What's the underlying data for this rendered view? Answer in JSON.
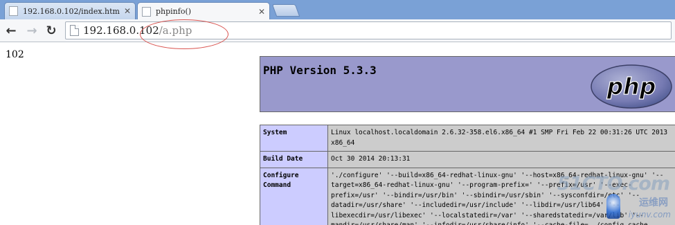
{
  "tabs": [
    {
      "title": "192.168.0.102/index.htm",
      "active": false
    },
    {
      "title": "phpinfo()",
      "active": true
    }
  ],
  "toolbar": {
    "back_icon": "back-arrow-icon",
    "forward_icon": "forward-arrow-icon",
    "reload_icon": "reload-icon",
    "url_host": "192.168.0.102",
    "url_path": "/a.php"
  },
  "page": {
    "output_text": "102",
    "php_version": "PHP Version 5.3.3",
    "logo_text": "php",
    "rows": [
      {
        "key": "System",
        "value": "Linux localhost.localdomain 2.6.32-358.el6.x86_64 #1 SMP Fri Feb 22 00:31:26 UTC 2013 x86_64"
      },
      {
        "key": "Build Date",
        "value": "Oct 30 2014 20:13:31"
      },
      {
        "key": "Configure Command",
        "value": "'./configure' '--build=x86_64-redhat-linux-gnu' '--host=x86_64-redhat-linux-gnu' '--target=x86_64-redhat-linux-gnu' '--program-prefix=' '--prefix=/usr' '--exec-prefix=/usr' '--bindir=/usr/bin' '--sbindir=/usr/sbin' '--sysconfdir=/etc' '--datadir=/usr/share' '--includedir=/usr/include' '--libdir=/usr/lib64' '--libexecdir=/usr/libexec' '--localstatedir=/var' '--sharedstatedir=/var/lib' '--mandir=/usr/share/man' '--infodir=/usr/share/info' '--cache-file=../config.cache"
      }
    ]
  },
  "watermark": {
    "line1": "51CTO.com",
    "line2": "运维网",
    "line3": "iyunv.com"
  },
  "colors": {
    "tabstrip": "#7aa1d6",
    "php_header": "#9999cc",
    "table_key": "#ccccff",
    "table_value": "#cccccc",
    "annotation": "#d9534f"
  }
}
